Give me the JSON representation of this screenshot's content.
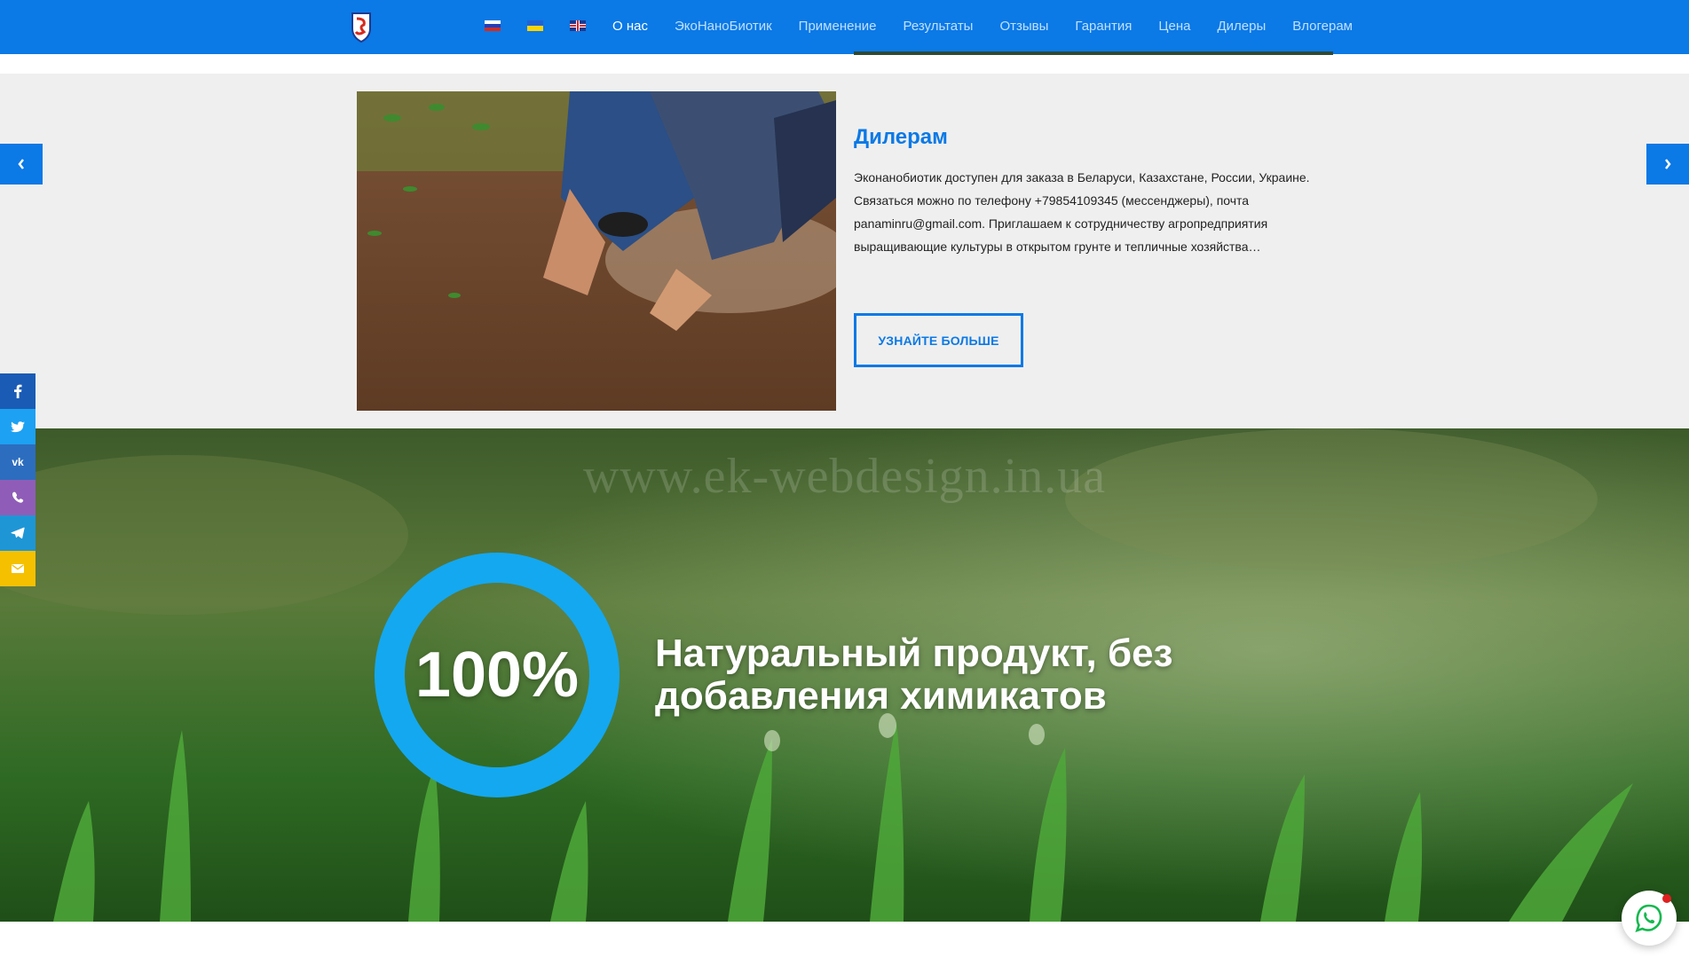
{
  "header": {
    "languages": [
      {
        "code": "ru",
        "icon": "flag-ru-icon"
      },
      {
        "code": "ua",
        "icon": "flag-ua-icon"
      },
      {
        "code": "en",
        "icon": "flag-uk-icon"
      }
    ],
    "nav": [
      {
        "label": "О нас",
        "active": true
      },
      {
        "label": "ЭкоНаноБиотик"
      },
      {
        "label": "Применение"
      },
      {
        "label": "Результаты"
      },
      {
        "label": "Отзывы"
      },
      {
        "label": "Гарантия"
      },
      {
        "label": "Цена"
      },
      {
        "label": "Дилеры"
      },
      {
        "label": "Влогерам"
      }
    ],
    "color": "#0b79e6"
  },
  "slider": {
    "title": "Дилерам",
    "text": "Эконанобиотик доступен для заказа в Беларуси, Казахстане, России, Украине. Связаться можно по телефону +79854109345 (мессенджеры), почта panaminru@gmail.com. Приглашаем к сотрудничеству агропредприятия выращивающие культуры в открытом грунте и тепличные хозяйства…",
    "button": "УЗНАЙТЕ БОЛЬШЕ",
    "prev_icon": "chevron-left-icon",
    "next_icon": "chevron-right-icon"
  },
  "hero": {
    "watermark": "www.ek-webdesign.in.ua",
    "value": "100%",
    "text": "Натуральный продукт, без добавления химикатов",
    "ring_color": "#14a8f0"
  },
  "social": [
    {
      "name": "facebook",
      "icon": "facebook-icon",
      "color": "#1a5bb5"
    },
    {
      "name": "twitter",
      "icon": "twitter-icon",
      "color": "#1da1f2"
    },
    {
      "name": "vk",
      "icon": "vk-icon",
      "color": "#2d6dbf"
    },
    {
      "name": "viber",
      "icon": "viber-icon",
      "color": "#8f5db7"
    },
    {
      "name": "telegram",
      "icon": "telegram-icon",
      "color": "#1e96d6"
    },
    {
      "name": "email",
      "icon": "email-icon",
      "color": "#f5c000"
    }
  ],
  "whatsapp": {
    "icon": "whatsapp-icon"
  }
}
